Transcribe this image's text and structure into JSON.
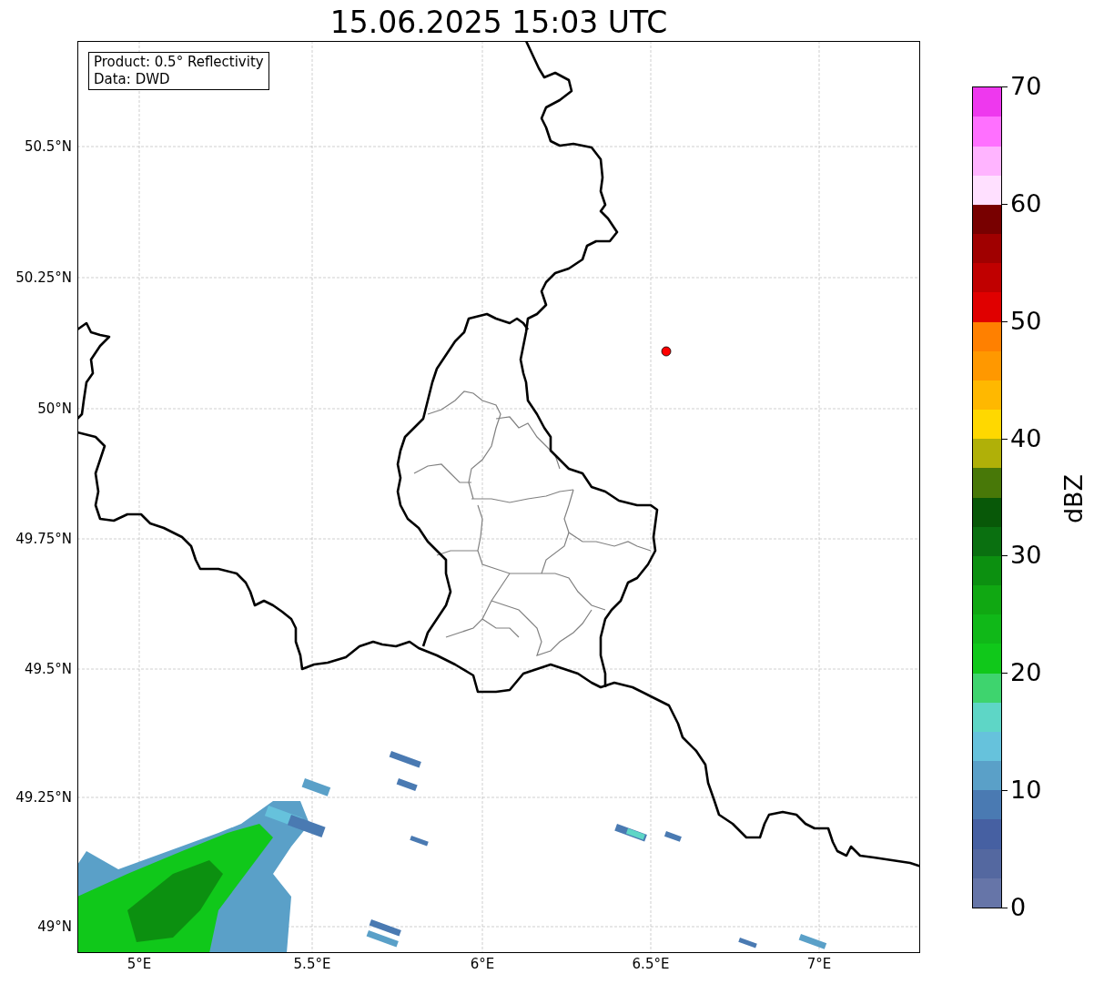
{
  "title": "15.06.2025 15:03 UTC",
  "info_box": [
    "Product: 0.5° Reflectivity",
    "Data: DWD"
  ],
  "x_ticks": [
    "5°E",
    "5.5°E",
    "6°E",
    "6.5°E",
    "7°E"
  ],
  "y_ticks": [
    "50.5°N",
    "50.25°N",
    "50°N",
    "49.75°N",
    "49.5°N",
    "49.25°N",
    "49°N"
  ],
  "colorbar": {
    "label": "dBZ",
    "ticks": [
      "70",
      "60",
      "50",
      "40",
      "30",
      "20",
      "10",
      "0"
    ],
    "segments": [
      {
        "color": "#6675a8"
      },
      {
        "color": "#5468a0"
      },
      {
        "color": "#4660a2"
      },
      {
        "color": "#4a7ab2"
      },
      {
        "color": "#5aa0c8"
      },
      {
        "color": "#66c2dc"
      },
      {
        "color": "#5ed6c6"
      },
      {
        "color": "#3ed46e"
      },
      {
        "color": "#10c81a"
      },
      {
        "color": "#10b818"
      },
      {
        "color": "#10a812"
      },
      {
        "color": "#0c9010"
      },
      {
        "color": "#0a7010"
      },
      {
        "color": "#085808"
      },
      {
        "color": "#487808"
      },
      {
        "color": "#b0b008"
      },
      {
        "color": "#ffd800"
      },
      {
        "color": "#ffb800"
      },
      {
        "color": "#ff9800"
      },
      {
        "color": "#ff8000"
      },
      {
        "color": "#e00000"
      },
      {
        "color": "#c00000"
      },
      {
        "color": "#a00000"
      },
      {
        "color": "#780000"
      },
      {
        "color": "#ffe0ff"
      },
      {
        "color": "#ffb4ff"
      },
      {
        "color": "#ff70ff"
      },
      {
        "color": "#ee38ee"
      }
    ]
  }
}
